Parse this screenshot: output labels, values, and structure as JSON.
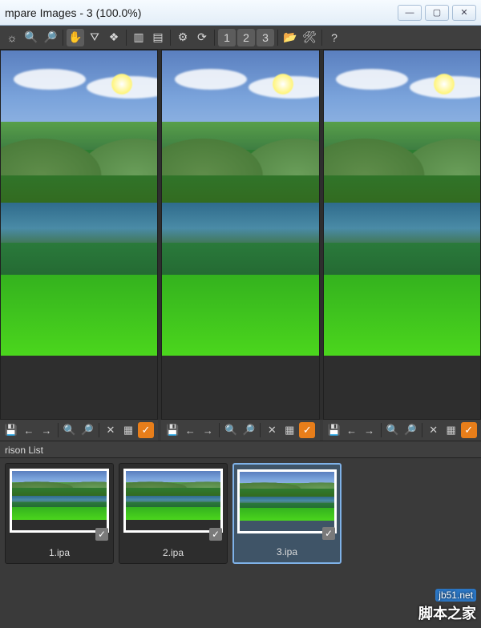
{
  "title": "mpare Images - 3 (100.0%)",
  "window_controls": {
    "min": "—",
    "max": "▢",
    "close": "✕"
  },
  "toolbar": {
    "items": [
      {
        "name": "tool-a",
        "glyph": "☼"
      },
      {
        "name": "zoom-in-icon",
        "glyph": "🔍"
      },
      {
        "name": "zoom-out-icon",
        "glyph": "🔎"
      },
      {
        "name": "sep"
      },
      {
        "name": "hand-tool-icon",
        "glyph": "✋",
        "sel": true
      },
      {
        "name": "histogram-icon",
        "glyph": "⛛"
      },
      {
        "name": "filter-icon",
        "glyph": "❖"
      },
      {
        "name": "sep"
      },
      {
        "name": "panel-a-icon",
        "glyph": "▥"
      },
      {
        "name": "panel-b-icon",
        "glyph": "▤"
      },
      {
        "name": "sep"
      },
      {
        "name": "gear-icon",
        "glyph": "⚙"
      },
      {
        "name": "refresh-icon",
        "glyph": "⟳"
      },
      {
        "name": "sep"
      },
      {
        "name": "layout-1-icon",
        "glyph": "1",
        "sel": true
      },
      {
        "name": "layout-2-icon",
        "glyph": "2",
        "sel": true
      },
      {
        "name": "layout-3-icon",
        "glyph": "3",
        "sel": true
      },
      {
        "name": "sep"
      },
      {
        "name": "open-icon",
        "glyph": "📂"
      },
      {
        "name": "settings-icon",
        "glyph": "🛠"
      },
      {
        "name": "sep"
      },
      {
        "name": "help-icon",
        "glyph": "?"
      }
    ]
  },
  "pane_toolbar": {
    "items": [
      {
        "name": "save-icon",
        "glyph": "💾"
      },
      {
        "name": "prev-icon",
        "glyph": "←"
      },
      {
        "name": "next-icon",
        "glyph": "→"
      },
      {
        "name": "sep"
      },
      {
        "name": "zoom-in-icon",
        "glyph": "🔍"
      },
      {
        "name": "zoom-out-icon",
        "glyph": "🔎"
      },
      {
        "name": "sep"
      },
      {
        "name": "close-pane-icon",
        "glyph": "✕"
      },
      {
        "name": "grid-icon",
        "glyph": "▦"
      },
      {
        "name": "check-icon",
        "glyph": "✓",
        "orange": true
      }
    ]
  },
  "list": {
    "header": "rison List",
    "thumbs": [
      {
        "name": "1.ipa",
        "selected": false
      },
      {
        "name": "2.ipa",
        "selected": false
      },
      {
        "name": "3.ipa",
        "selected": true
      }
    ]
  },
  "watermark": {
    "line1": "jb51.net",
    "line2": "脚本之家"
  }
}
